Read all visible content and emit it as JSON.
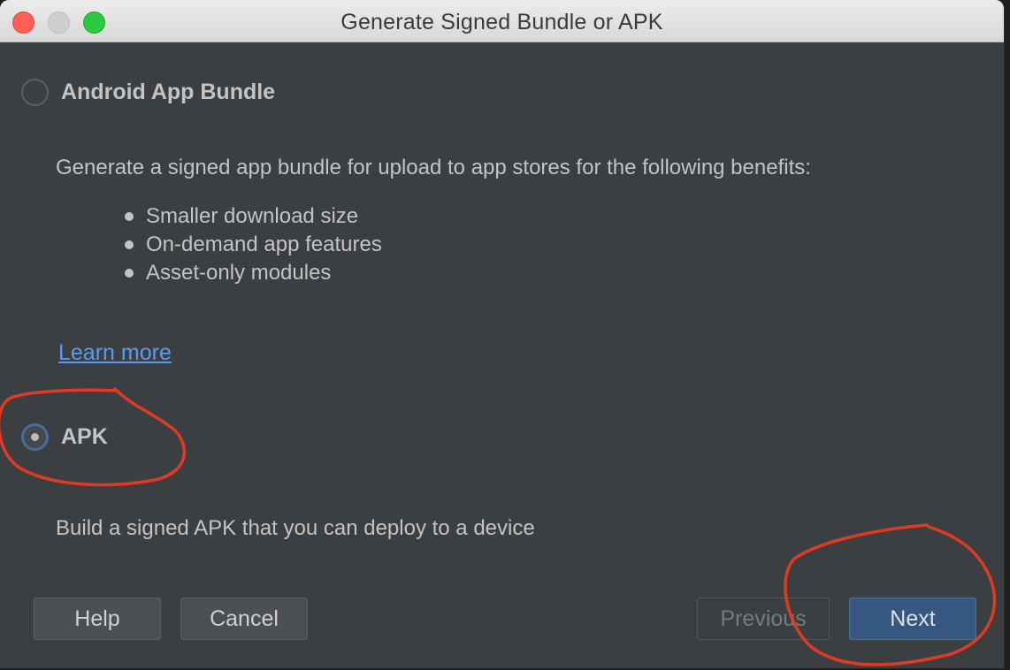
{
  "window": {
    "title": "Generate Signed Bundle or APK"
  },
  "options": {
    "bundle": {
      "label": "Android App Bundle",
      "selected": false,
      "description": "Generate a signed app bundle for upload to app stores for the following benefits:",
      "benefits": [
        "Smaller download size",
        "On-demand app features",
        "Asset-only modules"
      ],
      "link": "Learn more"
    },
    "apk": {
      "label": "APK",
      "selected": true,
      "description": "Build a signed APK that you can deploy to a device"
    }
  },
  "buttons": {
    "help": "Help",
    "cancel": "Cancel",
    "previous": "Previous",
    "next": "Next"
  },
  "colors": {
    "background": "#3c3f41",
    "primary_button": "#365880",
    "link": "#5a9bf0",
    "annotation": "#e03a24"
  }
}
